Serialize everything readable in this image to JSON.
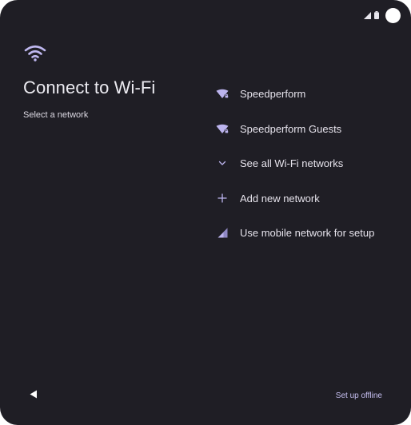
{
  "title": "Connect to Wi-Fi",
  "subtitle": "Select a network",
  "network_list": [
    {
      "label": "Speedperform",
      "icon": "wifi-lock-icon"
    },
    {
      "label": "Speedperform Guests",
      "icon": "wifi-lock-icon"
    },
    {
      "label": "See all Wi-Fi networks",
      "icon": "chevron-down-icon"
    },
    {
      "label": "Add new network",
      "icon": "plus-icon"
    },
    {
      "label": "Use mobile network for setup",
      "icon": "cellular-signal-icon"
    }
  ],
  "footer": {
    "offline_label": "Set up offline"
  },
  "colors": {
    "background": "#1f1e25",
    "accent": "#c7c0f2",
    "text": "#e6e3ec"
  }
}
